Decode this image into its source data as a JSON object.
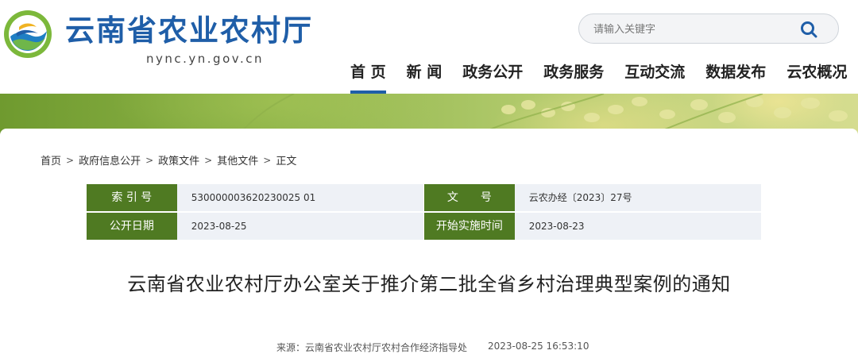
{
  "header": {
    "site_title": "云南省农业农村厅",
    "site_domain": "nync.yn.gov.cn",
    "search": {
      "placeholder": "请输入关键字"
    },
    "nav": [
      {
        "label": "首 页",
        "active": true
      },
      {
        "label": "新 闻"
      },
      {
        "label": "政务公开"
      },
      {
        "label": "政务服务"
      },
      {
        "label": "互动交流"
      },
      {
        "label": "数据发布"
      },
      {
        "label": "云农概况"
      }
    ]
  },
  "breadcrumb": [
    "首页",
    "政府信息公开",
    "政策文件",
    "其他文件",
    "正文"
  ],
  "breadcrumb_separator": ">",
  "meta": {
    "index_label": "索 引 号",
    "index_value": "530000003620230025 01",
    "doc_no_label": "文　　号",
    "doc_no_value": "云农办经〔2023〕27号",
    "publish_date_label": "公开日期",
    "publish_date_value": "2023-08-25",
    "effective_date_label": "开始实施时间",
    "effective_date_value": "2023-08-23"
  },
  "article": {
    "title": "云南省农业农村厅办公室关于推介第二批全省乡村治理典型案例的通知",
    "source": "来源：云南省农业农村厅农村合作经济指导处",
    "timestamp": "2023-08-25 16:53:10"
  },
  "colors": {
    "brand_blue": "#1f5ea8",
    "label_green": "#4f7a22",
    "value_bg": "#eef1f6"
  },
  "icons": {
    "search": "search-icon",
    "logo": "emblem-logo"
  }
}
